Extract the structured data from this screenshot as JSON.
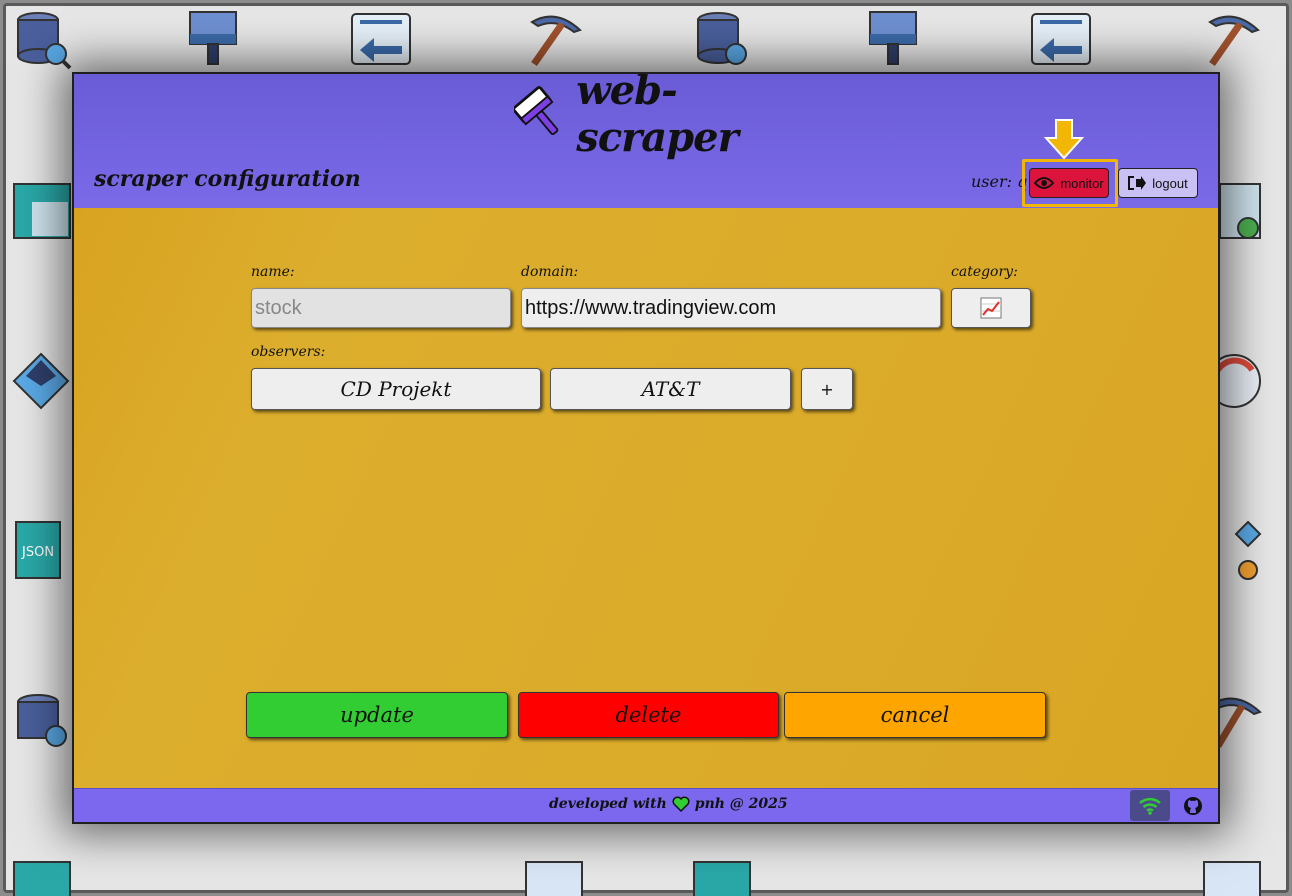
{
  "app": {
    "logo_text": "web-scraper",
    "page_title": "scraper configuration"
  },
  "header": {
    "user_label": "user: q",
    "monitor_label": "monitor",
    "logout_label": "logout"
  },
  "form": {
    "name_label": "name:",
    "name_value": "stock",
    "domain_label": "domain:",
    "domain_value": "https://www.tradingview.com",
    "category_label": "category:",
    "category_icon": "chart-increasing-icon",
    "observers_label": "observers:",
    "observers": [
      "CD Projekt",
      "AT&T"
    ],
    "add_observer_label": "+"
  },
  "actions": {
    "update_label": "update",
    "delete_label": "delete",
    "cancel_label": "cancel"
  },
  "footer": {
    "text_before": "developed with",
    "text_after": "pnh @ 2025",
    "heart_icon": "heart-icon",
    "wifi_icon": "wifi-icon",
    "github_icon": "github-icon"
  },
  "colors": {
    "header": "#7b68ee",
    "main_bg": "#dbab2a",
    "update": "#32cd32",
    "delete": "#ff0000",
    "cancel": "#ffa500",
    "monitor": "#dc143c",
    "logout": "#c9c0f3",
    "highlight": "#f2b705"
  }
}
